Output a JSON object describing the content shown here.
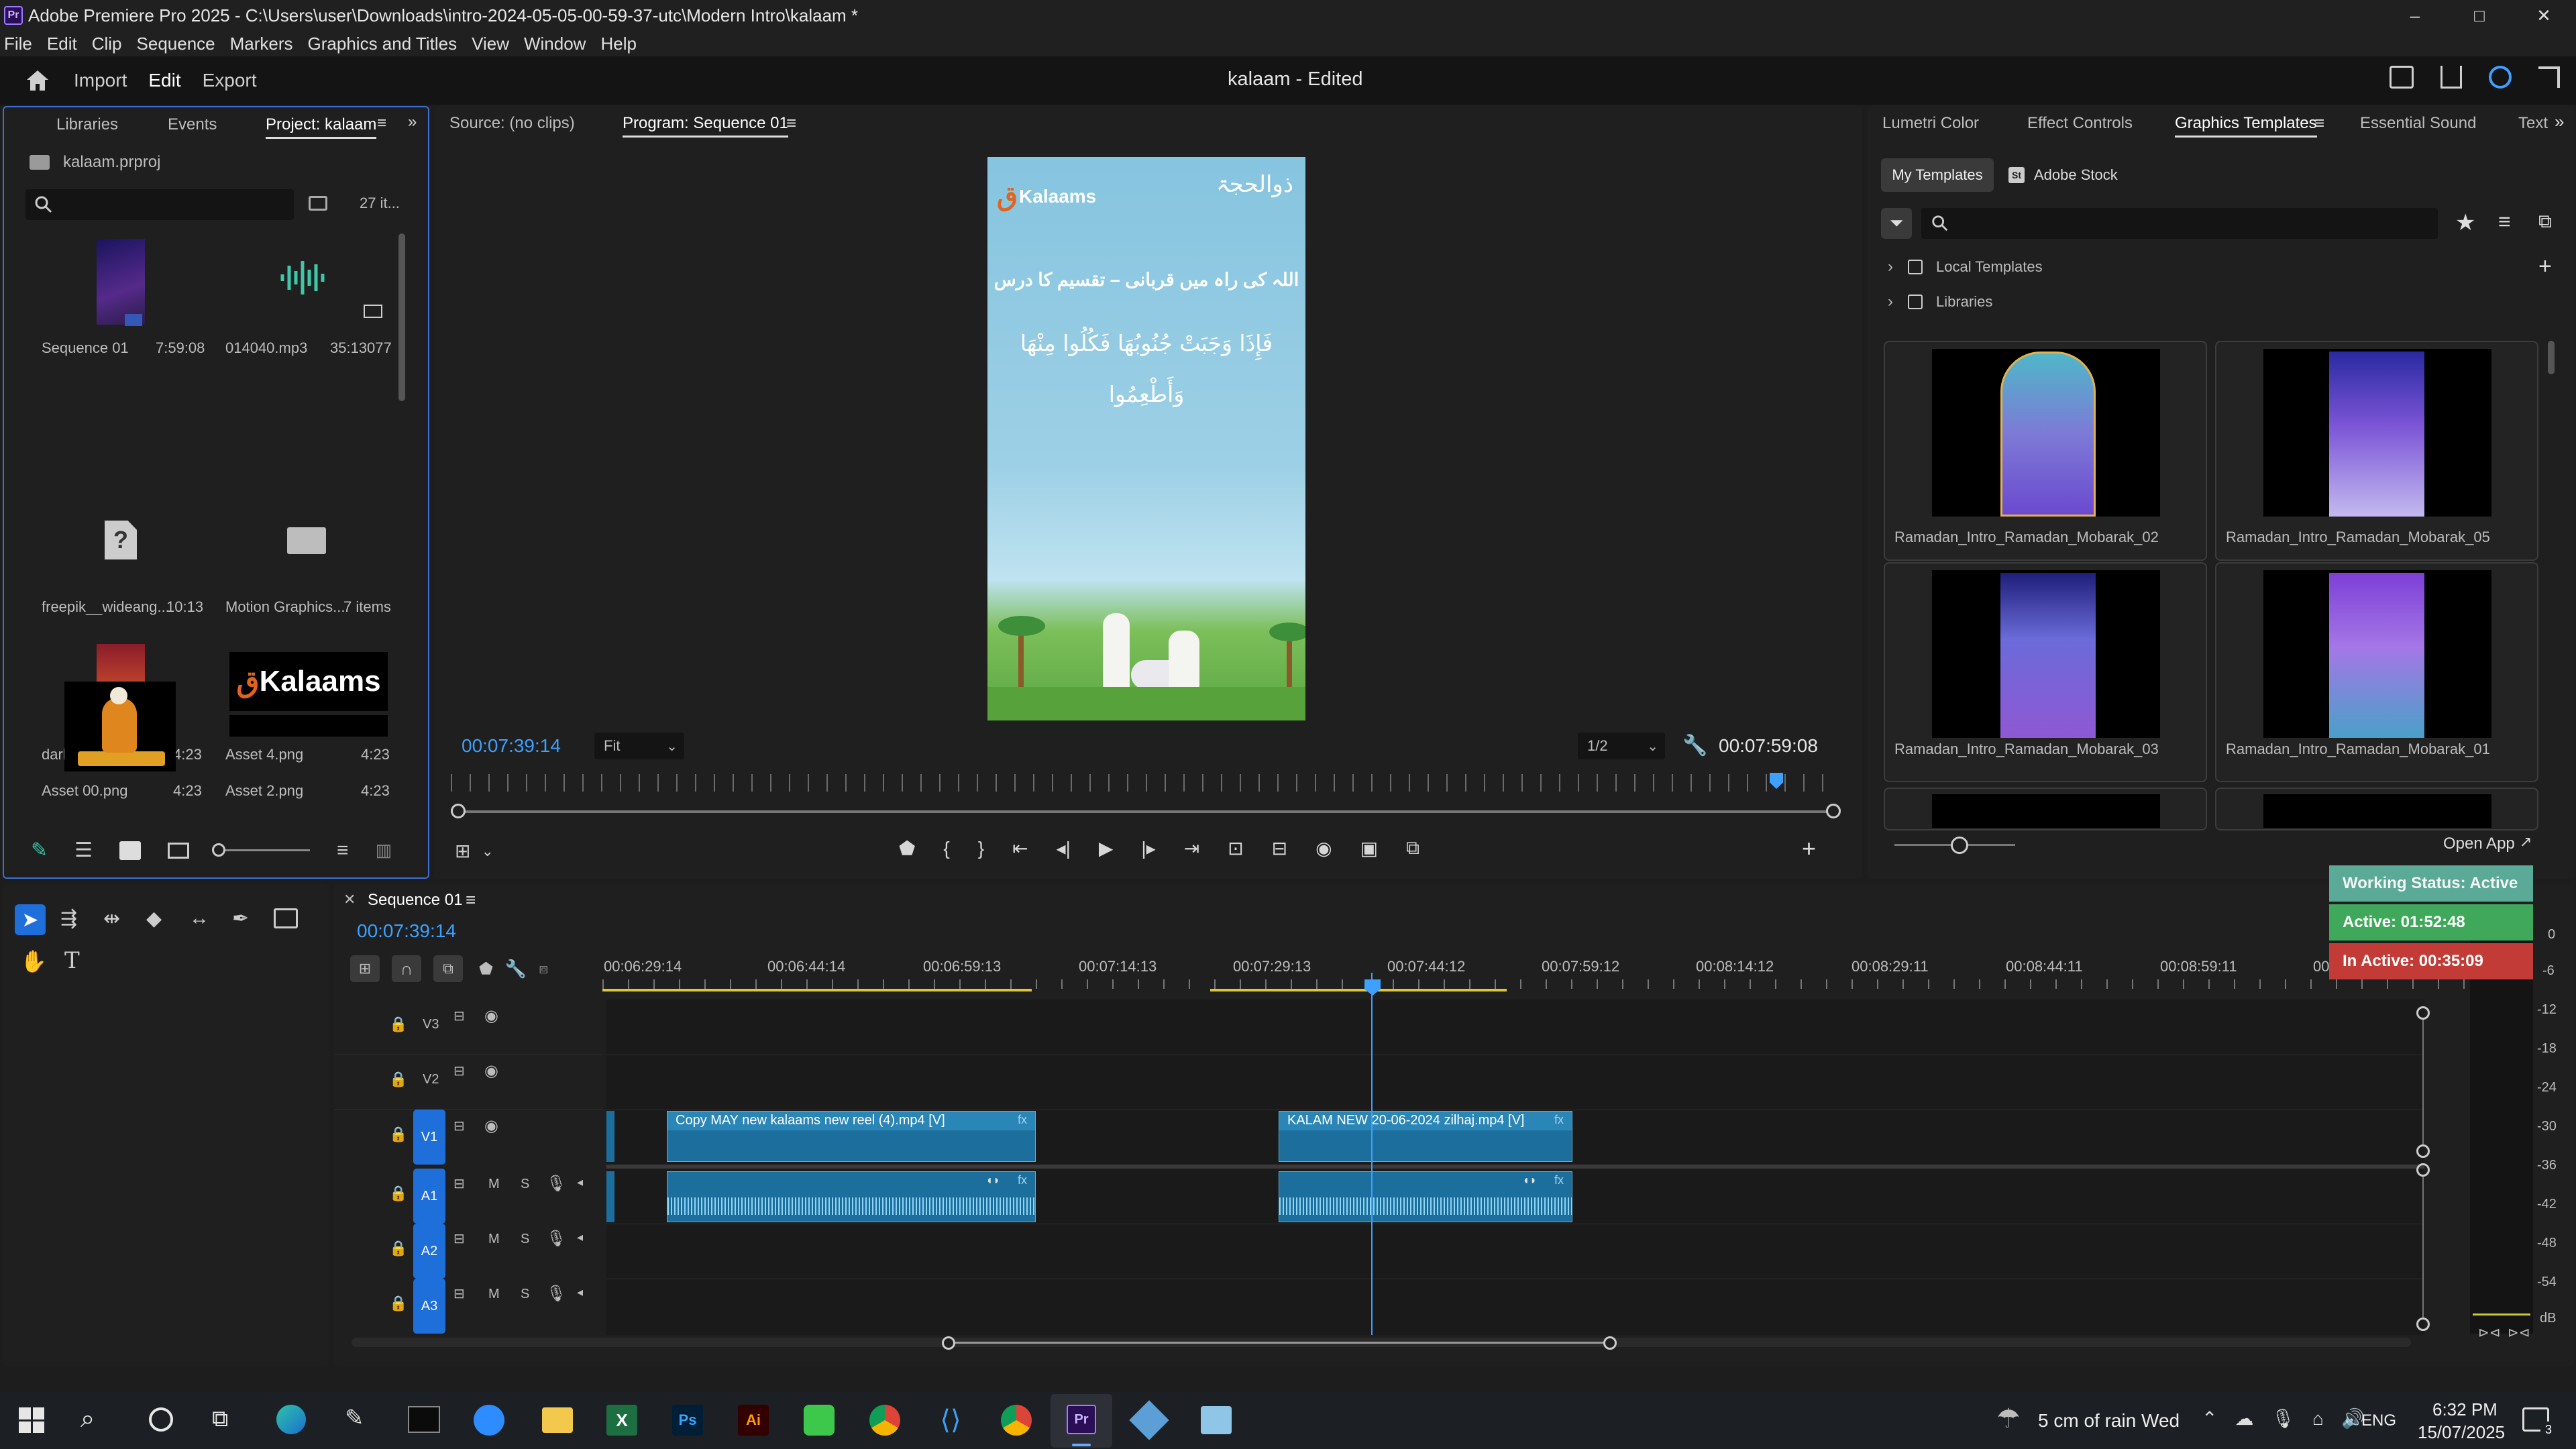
{
  "window": {
    "title": "Adobe Premiere Pro 2025 - C:\\Users\\user\\Downloads\\intro-2024-05-05-00-59-37-utc\\Modern Intro\\kalaam *",
    "app_badge": "Pr",
    "controls": {
      "minimize": "–",
      "maximize": "□",
      "close": "✕"
    }
  },
  "menu": [
    "File",
    "Edit",
    "Clip",
    "Sequence",
    "Markers",
    "Graphics and Titles",
    "View",
    "Window",
    "Help"
  ],
  "header": {
    "tabs": [
      "Import",
      "Edit",
      "Export"
    ],
    "active_tab": "Edit",
    "project_title": "kalaam - Edited"
  },
  "project_panel": {
    "tabs": [
      "Libraries",
      "Events",
      "Project: kalaam"
    ],
    "file": "kalaam.prproj",
    "count": "27 it...",
    "items": [
      {
        "name": "Sequence 01",
        "meta": "7:59:08",
        "type": "sequence"
      },
      {
        "name": "014040.mp3",
        "meta": "35:13077",
        "type": "audio"
      },
      {
        "name": "freepik__wideang...",
        "meta": "10:13",
        "type": "missing"
      },
      {
        "name": "Motion Graphics...",
        "meta": "7 items",
        "type": "folder"
      },
      {
        "name": "dark4.png",
        "meta": "4:23",
        "type": "image-dark"
      },
      {
        "name": "Asset 4.png",
        "meta": "4:23",
        "type": "logo"
      },
      {
        "name": "Asset 00.png",
        "meta": "4:23",
        "type": "pray"
      },
      {
        "name": "Asset 2.png",
        "meta": "4:23",
        "type": "logo-small"
      }
    ]
  },
  "source_panel": {
    "tab": "Source: (no clips)"
  },
  "program_panel": {
    "tab": "Program: Sequence 01",
    "timecode": "00:07:39:14",
    "fit": "Fit",
    "resolution": "1/2",
    "duration": "00:07:59:08",
    "playhead_fraction": 0.96,
    "frame": {
      "logo": "Kalaams",
      "badge": "ذوالحجۃ",
      "heading": "اللہ کی راہ میں قربانی – تقسیم کا درس",
      "verse1": "فَإِذَا وَجَبَتْ جُنُوبُهَا فَكُلُوا مِنْهَا",
      "verse2": "وَأَطْعِمُوا"
    }
  },
  "graphics_panel": {
    "tabs": [
      "Lumetri Color",
      "Effect Controls",
      "Graphics Templates",
      "Essential Sound",
      "Text"
    ],
    "active_tab": "Graphics Templates",
    "subtabs": [
      "My Templates",
      "Adobe Stock"
    ],
    "tree": [
      "Local Templates",
      "Libraries"
    ],
    "templates": [
      "Ramadan_Intro_Ramadan_Mobarak_02",
      "Ramadan_Intro_Ramadan_Mobarak_05",
      "Ramadan_Intro_Ramadan_Mobarak_03",
      "Ramadan_Intro_Ramadan_Mobarak_01"
    ],
    "open_app": "Open App"
  },
  "status_widget": {
    "working": "Working Status: Active",
    "active": "Active: 01:52:48",
    "inactive": "In Active: 00:35:09",
    "colors": {
      "working": "#5aaa97",
      "active": "#3fa85a",
      "inactive": "#c23b36"
    }
  },
  "timeline": {
    "sequence_tab": "Sequence 01",
    "timecode": "00:07:39:14",
    "ruler": [
      "00:06:29:14",
      "00:06:44:14",
      "00:06:59:13",
      "00:07:14:13",
      "00:07:29:13",
      "00:07:44:12",
      "00:07:59:12",
      "00:08:14:12",
      "00:08:29:11",
      "00:08:44:11",
      "00:08:59:11",
      "00:0"
    ],
    "tracks": [
      {
        "id": "V3",
        "kind": "video"
      },
      {
        "id": "V2",
        "kind": "video"
      },
      {
        "id": "V1",
        "kind": "video",
        "target": true
      },
      {
        "id": "A1",
        "kind": "audio",
        "target": true
      },
      {
        "id": "A2",
        "kind": "audio",
        "target": true
      },
      {
        "id": "A3",
        "kind": "audio",
        "target": true
      }
    ],
    "clips": [
      {
        "label": "Copy MAY new  kalaams new reel  (4).mp4 [V]"
      },
      {
        "label": "KALAM NEW 20-06-2024 zilhaj.mp4 [V]"
      }
    ],
    "track_letters": {
      "mute": "M",
      "solo": "S"
    }
  },
  "meter": {
    "scale": [
      "0",
      "-6",
      "-12",
      "-18",
      "-24",
      "-30",
      "-36",
      "-42",
      "-48",
      "-54",
      "dB"
    ]
  },
  "taskbar": {
    "weather": "5 cm of rain Wed",
    "lang": "ENG",
    "time": "6:32 PM",
    "date": "15/07/2025",
    "notifications": "3"
  }
}
